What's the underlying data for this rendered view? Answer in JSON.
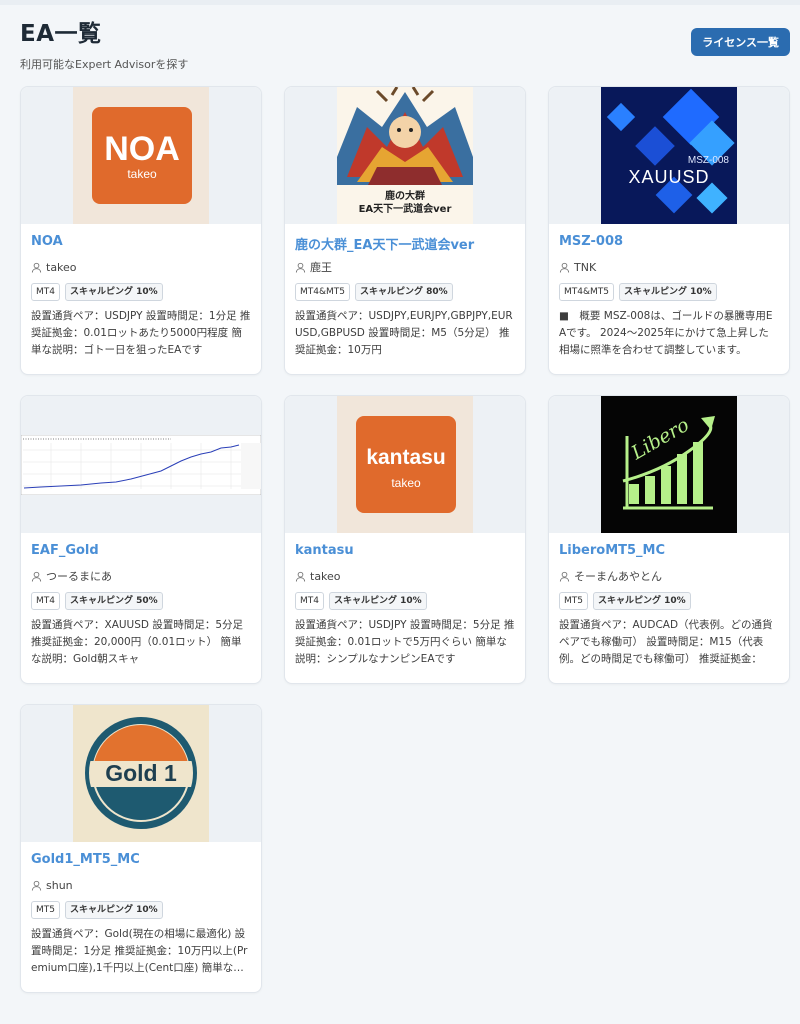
{
  "page": {
    "title": "EA一覧",
    "subtitle": "利用可能なExpert Advisorを探す",
    "license_button": "ライセンス一覧"
  },
  "colors": {
    "accent": "#2b6cb0",
    "title_link": "#4a8fd6",
    "logo_orange": "#e06a2c"
  },
  "cards": [
    {
      "title": "NOA",
      "author": "takeo",
      "platform": "MT4",
      "tag": "スキャルピング 10%",
      "thumb": {
        "type": "logo",
        "main": "NOA",
        "sub": "takeo"
      },
      "description": "設置通貨ペア：USDJPY 設置時間足：1分足 推奨証拠金：0.01ロットあたり5000円程度 簡単な説明：ゴトー日を狙ったEAです"
    },
    {
      "title": "鹿の大群_EA天下一武道会ver",
      "author": "鹿王",
      "platform": "MT4&MT5",
      "tag": "スキャルピング 80%",
      "thumb": {
        "type": "illustration",
        "line1": "鹿の大群",
        "line2": "EA天下一武道会ver"
      },
      "description": "設置通貨ペア：USDJPY,EURJPY,GBPJPY,EURUSD,GBPUSD 設置時間足：M5（5分足） 推奨証拠金：10万円"
    },
    {
      "title": "MSZ-008",
      "author": "TNK",
      "platform": "MT4&MT5",
      "tag": "スキャルピング 10%",
      "thumb": {
        "type": "xauusd",
        "code": "MSZ-008",
        "symbol": "XAUUSD"
      },
      "description": "■　概要 MSZ-008は、ゴールドの暴騰専用EAです。 2024〜2025年にかけて急上昇した相場に照準を合わせて調整しています。"
    },
    {
      "title": "EAF_Gold",
      "author": "つーるまにあ",
      "platform": "MT4",
      "tag": "スキャルピング 50%",
      "thumb": {
        "type": "chart"
      },
      "description": "設置通貨ペア：XAUUSD 設置時間足：5分足 推奨証拠金：20,000円（0.01ロット） 簡単な説明：Gold朝スキャ"
    },
    {
      "title": "kantasu",
      "author": "takeo",
      "platform": "MT4",
      "tag": "スキャルピング 10%",
      "thumb": {
        "type": "logo",
        "main": "kantasu",
        "sub": "takeo"
      },
      "description": "設置通貨ペア：USDJPY 設置時間足：5分足 推奨証拠金：0.01ロットで5万円ぐらい 簡単な説明：シンプルなナンピンEAです"
    },
    {
      "title": "LiberoMT5_MC",
      "author": "そーまんあやとん",
      "platform": "MT5",
      "tag": "スキャルピング 10%",
      "thumb": {
        "type": "libero",
        "word": "Libero"
      },
      "description": "設置通貨ペア：AUDCAD（代表例。どの通貨ペアでも稼働可） 設置時間足：M15（代表例。どの時間足でも稼働可） 推奨証拠金："
    },
    {
      "title": "Gold1_MT5_MC",
      "author": "shun",
      "platform": "MT5",
      "tag": "スキャルピング 10%",
      "thumb": {
        "type": "badge",
        "word": "Gold 1"
      },
      "description": "設置通貨ペア：Gold(現在の相場に最適化) 設置時間足：1分足 推奨証拠金：10万円以上(Premium口座),1千円以上(Cent口座) 簡単な説明"
    }
  ]
}
